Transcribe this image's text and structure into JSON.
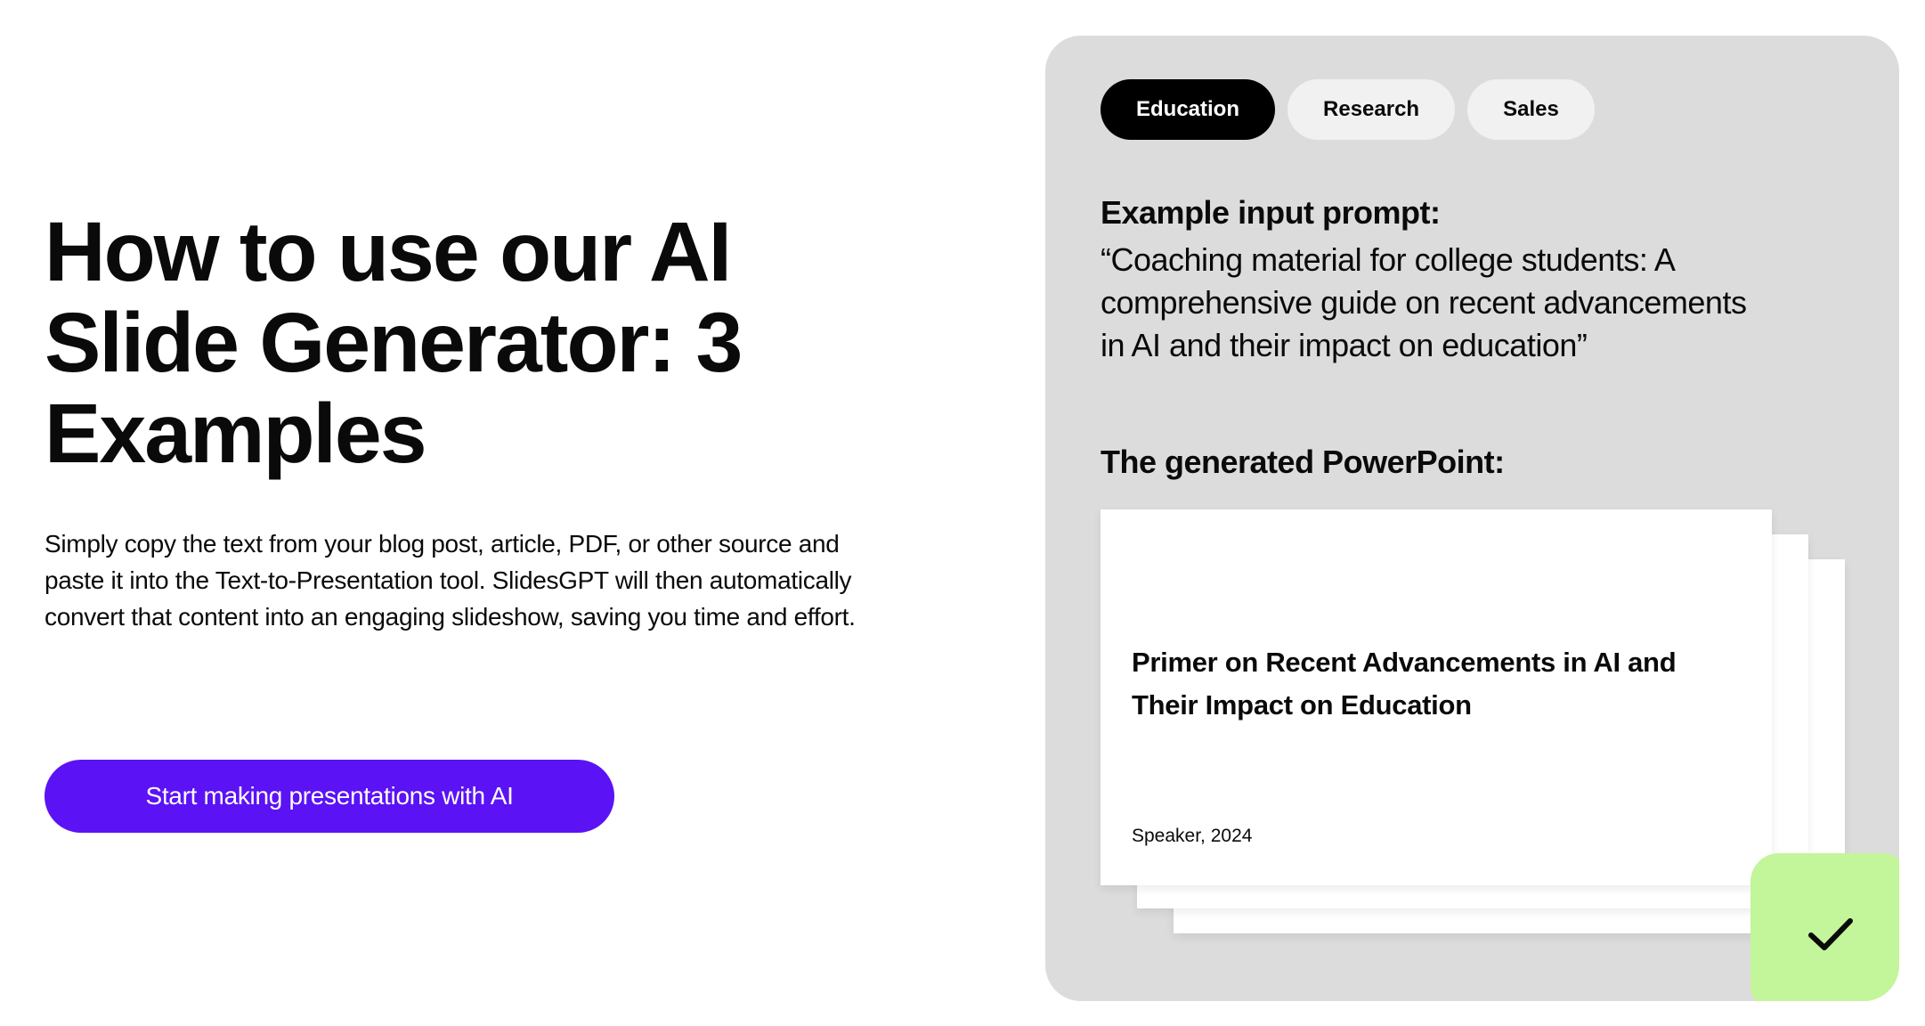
{
  "main": {
    "heading": "How to use our AI Slide Generator: 3 Examples",
    "description": "Simply copy the text from your blog post, article, PDF, or other source and paste it into the Text-to-Presentation tool. SlidesGPT will then automatically convert that content into an engaging slideshow, saving you time and effort.",
    "cta_label": "Start making presentations with AI"
  },
  "examples": {
    "tabs": [
      {
        "label": "Education",
        "active": true
      },
      {
        "label": "Research",
        "active": false
      },
      {
        "label": "Sales",
        "active": false
      }
    ],
    "prompt_label": "Example input prompt:",
    "prompt_text": "“Coaching material for college students: A comprehensive guide on recent advancements in AI and their impact on education”",
    "generated_label": "The generated PowerPoint:",
    "slide": {
      "title": "Primer on Recent Advancements in AI and Their Impact on Education",
      "meta": "Speaker, 2024"
    }
  },
  "colors": {
    "cta": "#5b12f5",
    "panel": "#dcdcdc",
    "active_tab": "#000000",
    "check_badge": "#c3f59a"
  },
  "icons": {
    "check": "checkmark-icon"
  }
}
